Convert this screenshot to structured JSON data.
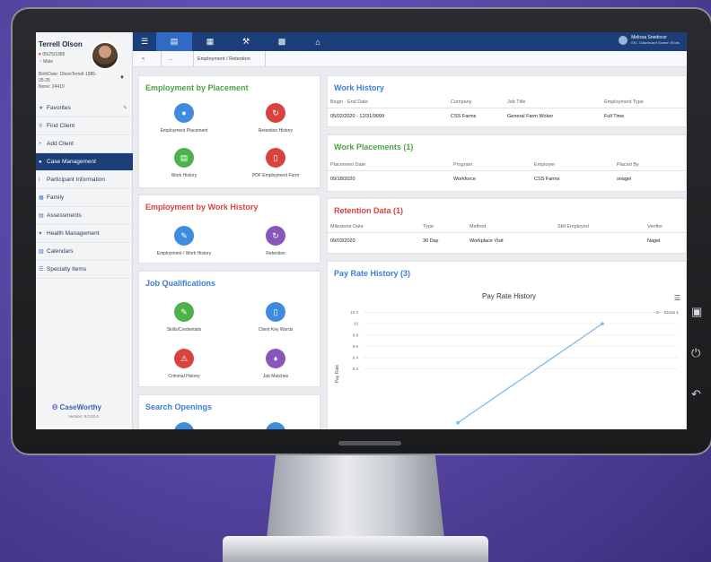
{
  "client": {
    "name": "Terrell Olson",
    "birth": "05/25/1985",
    "gender": "Male",
    "details_line1": "BirthDate: OlsonTerrell-1985-",
    "details_line2": "05-25",
    "details_line3": "None: 24419"
  },
  "sidebar": {
    "items": [
      {
        "label": "Favorites",
        "icon": "star-icon"
      },
      {
        "label": "Find Client",
        "icon": "search-icon"
      },
      {
        "label": "Add Client",
        "icon": "plus-icon"
      },
      {
        "label": "Case Management",
        "icon": "user-icon",
        "active": true
      },
      {
        "label": "Participant Information",
        "icon": "info-icon"
      },
      {
        "label": "Family",
        "icon": "family-icon"
      },
      {
        "label": "Assessments",
        "icon": "clipboard-icon"
      },
      {
        "label": "Health Management",
        "icon": "heart-icon"
      },
      {
        "label": "Calendars",
        "icon": "calendar-icon"
      },
      {
        "label": "Specialty Items",
        "icon": "list-icon"
      }
    ],
    "brand": "CaseWorthy",
    "version": "Version: 8.0.20.4"
  },
  "user": {
    "name": "Melissa Snedecor",
    "role": "EN - Dashboard Screen Shots"
  },
  "breadcrumb": {
    "back": "<",
    "ellipsis": "...",
    "current": "Employment / Retention"
  },
  "employment_by_placement": {
    "title": "Employment by Placement",
    "tiles": [
      "Employment Placement",
      "Retention History",
      "Work History",
      "PDF Employment Form"
    ]
  },
  "employment_by_work_history": {
    "title": "Employment by Work History",
    "tiles": [
      "Employment / Work History",
      "Retention"
    ]
  },
  "job_qualifications": {
    "title": "Job Qualifications",
    "tiles": [
      "Skills/Credentials",
      "Client Key Words",
      "Criminal History",
      "Job Matches"
    ]
  },
  "search_openings": {
    "title": "Search Openings"
  },
  "work_history": {
    "title": "Work History",
    "columns": [
      "Begin - End Date",
      "Company",
      "Job Title",
      "Employment Type"
    ],
    "rows": [
      [
        "05/02/2020 - 12/31/9999",
        "CSS Farms",
        "General Farm Woker",
        "Full Time"
      ]
    ]
  },
  "work_placements": {
    "title": "Work Placements (1)",
    "columns": [
      "Placement Date",
      "Program",
      "Employer",
      "Placed By"
    ],
    "rows": [
      [
        "09/18/2020",
        "Workforce",
        "CSS Farms",
        "snagel"
      ]
    ]
  },
  "retention_data": {
    "title": "Retention Data (1)",
    "columns": [
      "Milestone Date",
      "Type",
      "Method",
      "Still Employed",
      "Verifier"
    ],
    "rows": [
      [
        "09/03/2020",
        "30 Day",
        "Workplace Visit",
        "",
        "Nagel"
      ]
    ]
  },
  "pay_rate_history": {
    "title": "Pay Rate History (3)",
    "chart_data": {
      "type": "line",
      "title": "Pay Rate History",
      "ylabel": "Pay Rate",
      "x": [
        "08/14/2020",
        "08/19/2020"
      ],
      "series": [
        {
          "name": "Series 1",
          "values": [
            8.25,
            10.0
          ]
        }
      ],
      "yticks": [
        10.2,
        10,
        9.8,
        9.6,
        9.4,
        9.2
      ],
      "ylim": [
        8.15,
        10.35
      ],
      "color": "#7cb5ec"
    }
  }
}
